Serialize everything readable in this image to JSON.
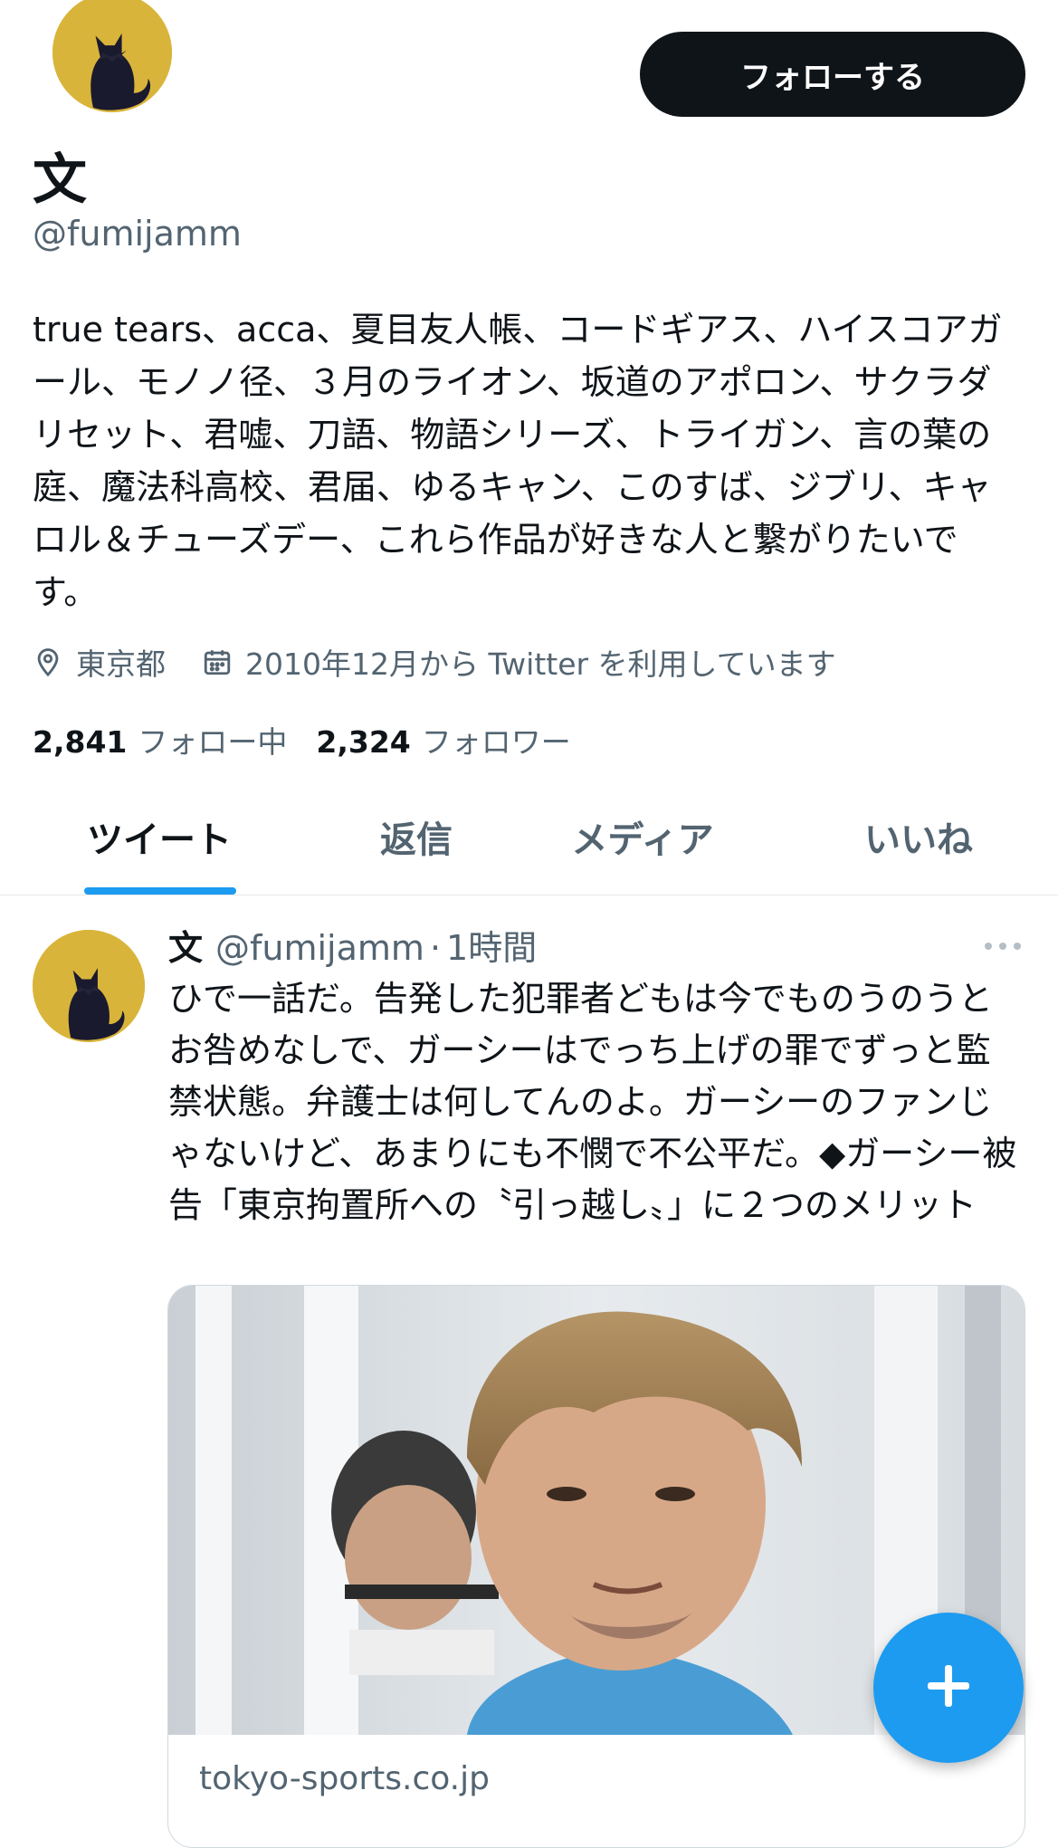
{
  "profile": {
    "display_name": "文",
    "handle": "@fumijamm",
    "follow_label": "フォローする",
    "bio": "true tears、acca、夏目友人帳、コードギアス、ハイスコアガール、モノノ径、３月のライオン、坂道のアポロン、サクラダリセット、君嘘、刀語、物語シリーズ、トライガン、言の葉の庭、魔法科高校、君届、ゆるキャン、このすば、ジブリ、キャロル＆チューズデー、これら作品が好きな人と繋がりたいです。",
    "location": "東京都",
    "joined": "2010年12月から Twitter を利用しています",
    "location_icon": "location-pin-icon",
    "joined_icon": "calendar-icon",
    "avatar_icon": "cat-avatar",
    "avatar_color": "#d9b43a"
  },
  "stats": {
    "following_count": "2,841",
    "following_label": "フォロー中",
    "followers_count": "2,324",
    "followers_label": "フォロワー"
  },
  "tabs": {
    "tweets": "ツイート",
    "replies": "返信",
    "media": "メディア",
    "likes": "いいね",
    "active": "tweets"
  },
  "tweet": {
    "author_name": "文",
    "author_handle": "@fumijamm",
    "separator": "·",
    "time": "1時間",
    "text": "ひで一話だ。告発した犯罪者どもは今でものうのうとお咎めなしで、ガーシーはでっち上げの罪でずっと監禁状態。弁護士は何してんのよ。ガーシーのファンじゃないけど、あまりにも不憫で不公平だ。◆ガーシー被告「東京拘置所への〝引っ越し〟」に２つのメリット",
    "more_icon": "more-options-icon",
    "link_card": {
      "domain": "tokyo-sports.co.jp",
      "image": "news-photo"
    }
  },
  "compose": {
    "icon": "plus-icon"
  },
  "colors": {
    "accent": "#1d9bf0",
    "text": "#0f1419",
    "secondary": "#536471",
    "follow_button": "#0f1419"
  }
}
